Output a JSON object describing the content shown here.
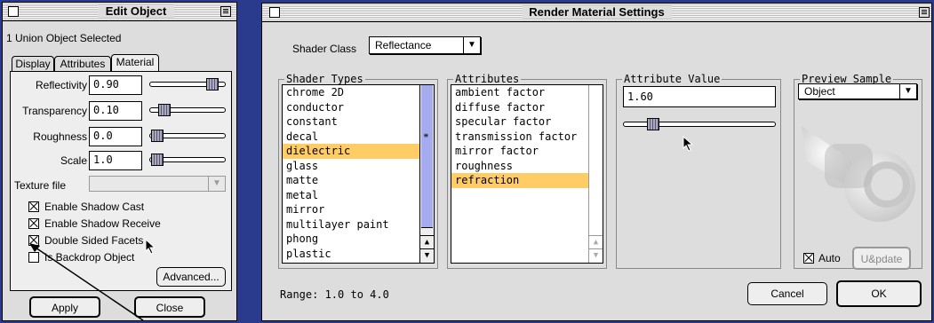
{
  "edit_window": {
    "title": "Edit Object",
    "selection_status": "1 Union Object Selected",
    "tabs": [
      {
        "label": "Display",
        "active": false
      },
      {
        "label": "Attributes",
        "active": false
      },
      {
        "label": "Material",
        "active": true
      }
    ],
    "properties": [
      {
        "label": "Reflectivity",
        "value": "0.90",
        "slider_fraction": 0.83
      },
      {
        "label": "Transparency",
        "value": "0.10",
        "slider_fraction": 0.2
      },
      {
        "label": "Roughness",
        "value": "0.0",
        "slider_fraction": 0.1
      },
      {
        "label": "Scale",
        "value": "1.0",
        "slider_fraction": 0.1
      }
    ],
    "texture_file_label": "Texture file",
    "texture_file_value": "",
    "checkboxes": [
      {
        "label": "Enable Shadow Cast",
        "checked": true
      },
      {
        "label": "Enable Shadow Receive",
        "checked": true
      },
      {
        "label": "Double Sided Facets",
        "checked": true
      },
      {
        "label": "Is Backdrop Object",
        "checked": false
      }
    ],
    "advanced_label": "Advanced...",
    "apply_label": "Apply",
    "close_label": "Close"
  },
  "render_window": {
    "title": "Render Material Settings",
    "shader_class_label": "Shader Class",
    "shader_class_value": "Reflectance",
    "shader_types_label": "Shader Types",
    "shader_types": [
      "chrome 2D",
      "conductor",
      "constant",
      "decal",
      "dielectric",
      "glass",
      "matte",
      "metal",
      "mirror",
      "multilayer paint",
      "phong",
      "plastic"
    ],
    "shader_types_selected": 4,
    "attributes_label": "Attributes",
    "attributes": [
      "ambient factor",
      "diffuse factor",
      "specular factor",
      "transmission factor",
      "mirror factor",
      "roughness",
      "refraction"
    ],
    "attributes_selected": 6,
    "attribute_value_label": "Attribute Value",
    "attribute_value": "1.60",
    "attribute_slider_fraction": 0.2,
    "preview_label": "Preview Sample",
    "preview_object": "Object",
    "auto_label": "Auto",
    "auto_checked": true,
    "update_label": "U&pdate",
    "range_text": "Range: 1.0 to 4.0",
    "cancel_label": "Cancel",
    "ok_label": "OK"
  }
}
